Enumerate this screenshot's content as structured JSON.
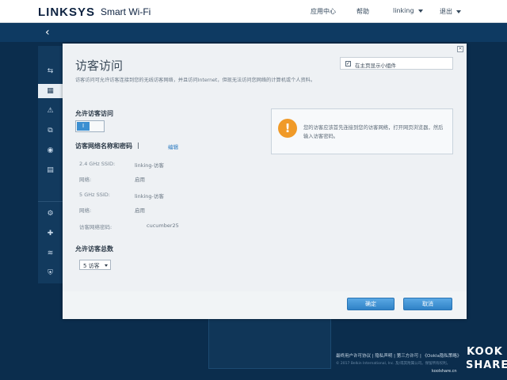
{
  "header": {
    "logo": "LINKSYS",
    "logo_sub": "Smart Wi-Fi",
    "nav": {
      "app_center": "应用中心",
      "help": "帮助",
      "user": "linking",
      "logout": "退出"
    }
  },
  "sidebar": {
    "back_glyph": "‹",
    "items": [
      {
        "icon": "router-map-icon",
        "glyph": "⇆",
        "active": false
      },
      {
        "icon": "guest-access-icon",
        "glyph": "▦",
        "active": true
      },
      {
        "icon": "alert-icon",
        "glyph": "⚠",
        "active": false
      },
      {
        "icon": "parental-controls-icon",
        "glyph": "⧉",
        "active": false
      },
      {
        "icon": "media-prioritization-icon",
        "glyph": "◉",
        "active": false
      },
      {
        "icon": "speed-test-icon",
        "glyph": "▤",
        "active": false
      },
      {
        "icon": "connectivity-icon",
        "glyph": "⚙",
        "active": false
      },
      {
        "icon": "troubleshooting-icon",
        "glyph": "✚",
        "active": false
      },
      {
        "icon": "wireless-icon",
        "glyph": "≋",
        "active": false
      },
      {
        "icon": "security-icon",
        "glyph": "⛨",
        "active": false
      }
    ]
  },
  "modal": {
    "close_glyph": "✕",
    "title": "访客访问",
    "description": "访客访问可允许访客连接到您的无线访客网络，并且访问Internet，但现无法访问您网络的计算机或个人资料。",
    "show_widget": {
      "label": "在主页显示小组件",
      "checked": true,
      "check_glyph": "✓"
    },
    "allow_guest": {
      "label": "允许访客访问",
      "toggle_text": "I"
    },
    "network": {
      "label": "访客网络名称和密码",
      "separator": "|",
      "edit": "编辑",
      "fields": [
        {
          "key": "2.4 GHz SSID:",
          "value": "linking-访客"
        },
        {
          "key": "网络:",
          "value": "启用"
        },
        {
          "key": "5 GHz SSID:",
          "value": "linking-访客"
        },
        {
          "key": "网络:",
          "value": "启用"
        },
        {
          "key": "访客网络密码:",
          "value": "cucumber25"
        }
      ]
    },
    "total_guests": {
      "label": "允许访客总数",
      "value": "5 访客"
    },
    "info": {
      "icon_glyph": "!",
      "text": "您的访客应该首先连接到您的访客网络，打开网页浏览器，然后输入访客密码。"
    },
    "buttons": {
      "ok": "确定",
      "cancel": "取消"
    }
  },
  "footer": {
    "links": "最终用户许可协议 | 隐私声明 | 第三方许可 | 《Ookla隐私策略》",
    "copyright": "© 2017 Belkin International, Inc. 及/或其附属公司。保留所有权利。"
  },
  "watermark": {
    "top": "KOOK",
    "bottom": "SHARE",
    "url": "koolshare.cn"
  }
}
